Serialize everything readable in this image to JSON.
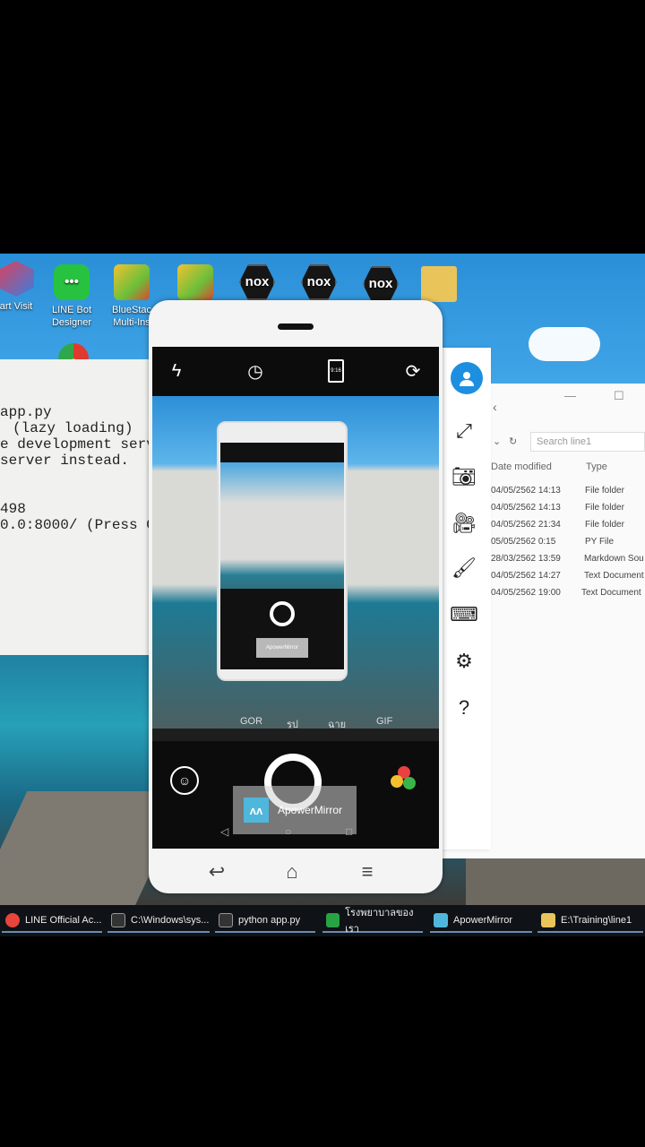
{
  "desktop": {
    "icons": [
      {
        "label": "art Visit",
        "icon": "cube-icon"
      },
      {
        "label": "LINE Bot\nDesigner",
        "icon": "line-icon"
      },
      {
        "label": "BlueStac\nMulti-Ins",
        "icon": "bluestacks-icon"
      },
      {
        "label": "",
        "icon": "bluestacks-icon"
      },
      {
        "label": "nox",
        "icon": "nox-icon"
      },
      {
        "label": "nox",
        "icon": "nox-icon"
      },
      {
        "label": "nox",
        "icon": "nox-icon"
      },
      {
        "label": "",
        "icon": "folder-icon"
      }
    ]
  },
  "terminal": {
    "lines": [
      "app.py",
      "(lazy loading)",
      "e development serv",
      "server instead.",
      "",
      "",
      "498",
      "0.0:8000/ (Press C"
    ]
  },
  "explorer": {
    "search_placeholder": "Search line1",
    "col_date": "Date modified",
    "col_type": "Type",
    "rows": [
      {
        "date": "04/05/2562 14:13",
        "type": "File folder"
      },
      {
        "date": "04/05/2562 14:13",
        "type": "File folder"
      },
      {
        "date": "04/05/2562 21:34",
        "type": "File folder"
      },
      {
        "date": "05/05/2562 0:15",
        "type": "PY File"
      },
      {
        "date": "28/03/2562 13:59",
        "type": "Markdown Sou"
      },
      {
        "date": "04/05/2562 14:27",
        "type": "Text Document"
      },
      {
        "date": "04/05/2562 19:00",
        "type": "Text Document"
      }
    ]
  },
  "phone": {
    "camera_top": {
      "ratio_label": "9:16"
    },
    "modes": [
      "GOR",
      "รูป",
      "ฉาย",
      "GIF"
    ],
    "overlay_text": "ApowerMirror",
    "inner_overlay_text": "ApowerMirror"
  },
  "taskbar": {
    "items": [
      {
        "label": "LINE Official Ac...",
        "color": "#e8453c"
      },
      {
        "label": "C:\\Windows\\sys...",
        "color": "#444444"
      },
      {
        "label": "python  app.py",
        "color": "#444444"
      },
      {
        "label": "โรงพยาบาลของเรา",
        "color": "#27a344"
      },
      {
        "label": "ApowerMirror",
        "color": "#4fb7dc"
      },
      {
        "label": "E:\\Training\\line1",
        "color": "#e9c45a"
      }
    ]
  }
}
